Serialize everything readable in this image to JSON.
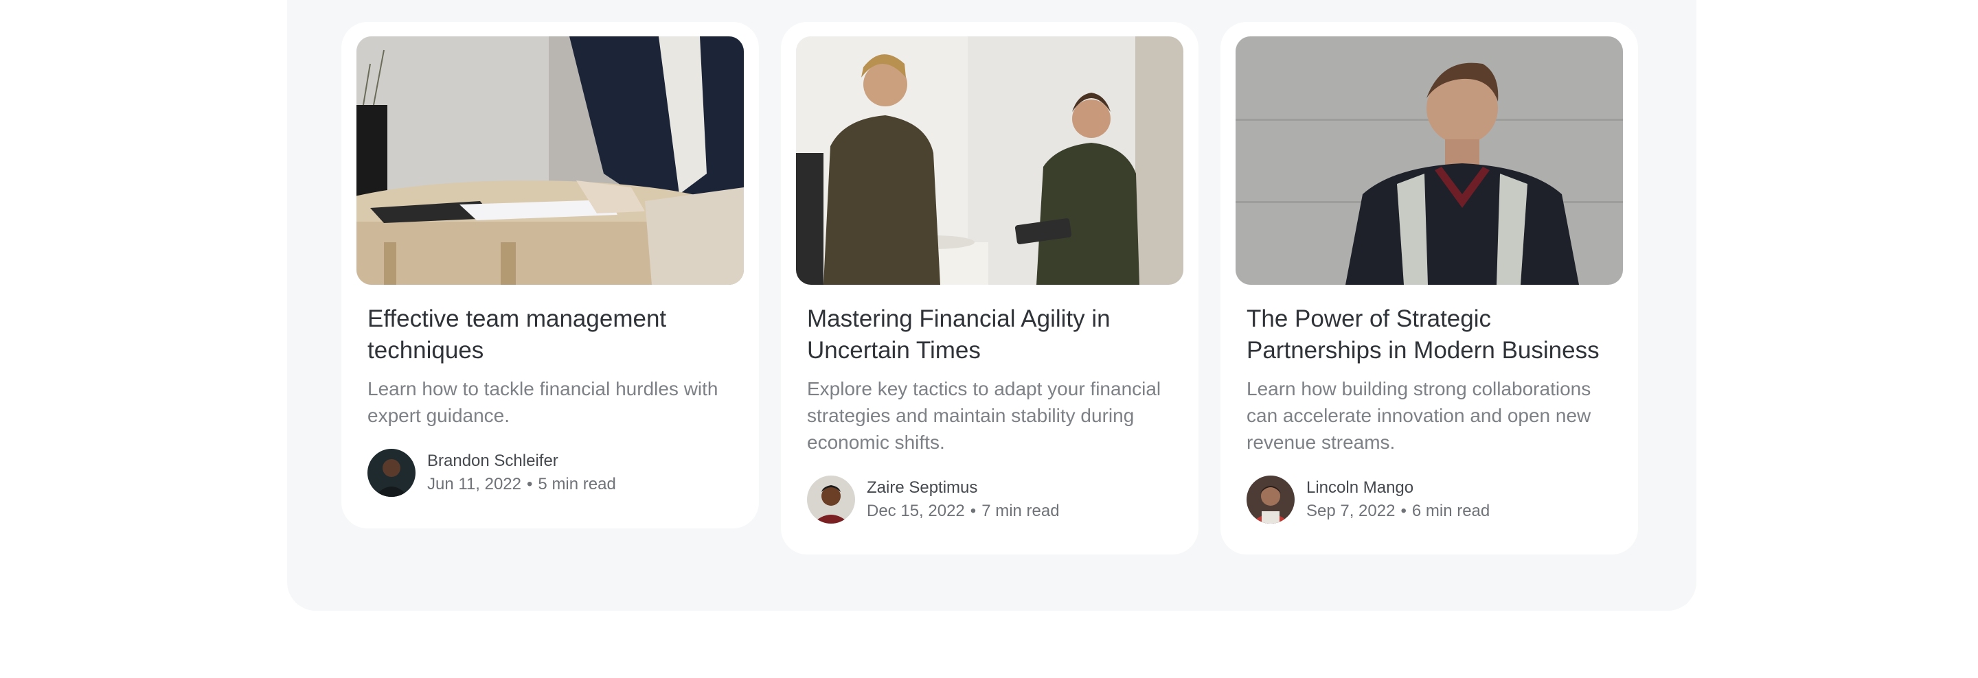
{
  "posts": [
    {
      "title": "Effective team management techniques",
      "excerpt": "Learn how to tackle financial hurdles with expert guidance.",
      "author": "Brandon Schleifer",
      "date": "Jun 11, 2022",
      "separator": "•",
      "read_time": "5 min read"
    },
    {
      "title": "Mastering Financial Agility in Uncertain Times",
      "excerpt": "Explore key tactics to adapt your financial strategies and maintain stability during economic shifts.",
      "author": "Zaire Septimus",
      "date": "Dec 15, 2022",
      "separator": "•",
      "read_time": "7 min read"
    },
    {
      "title": "The Power of Strategic Partnerships in Modern Business",
      "excerpt": "Learn how building strong collaborations can accelerate innovation and open new revenue streams.",
      "author": "Lincoln Mango",
      "date": "Sep 7, 2022",
      "separator": "•",
      "read_time": "6 min read"
    }
  ],
  "colors": {
    "section_bg": "#f6f7f9",
    "card_bg": "#ffffff",
    "title": "#2f3338",
    "excerpt": "#7d8186",
    "meta": "#6f7378"
  }
}
